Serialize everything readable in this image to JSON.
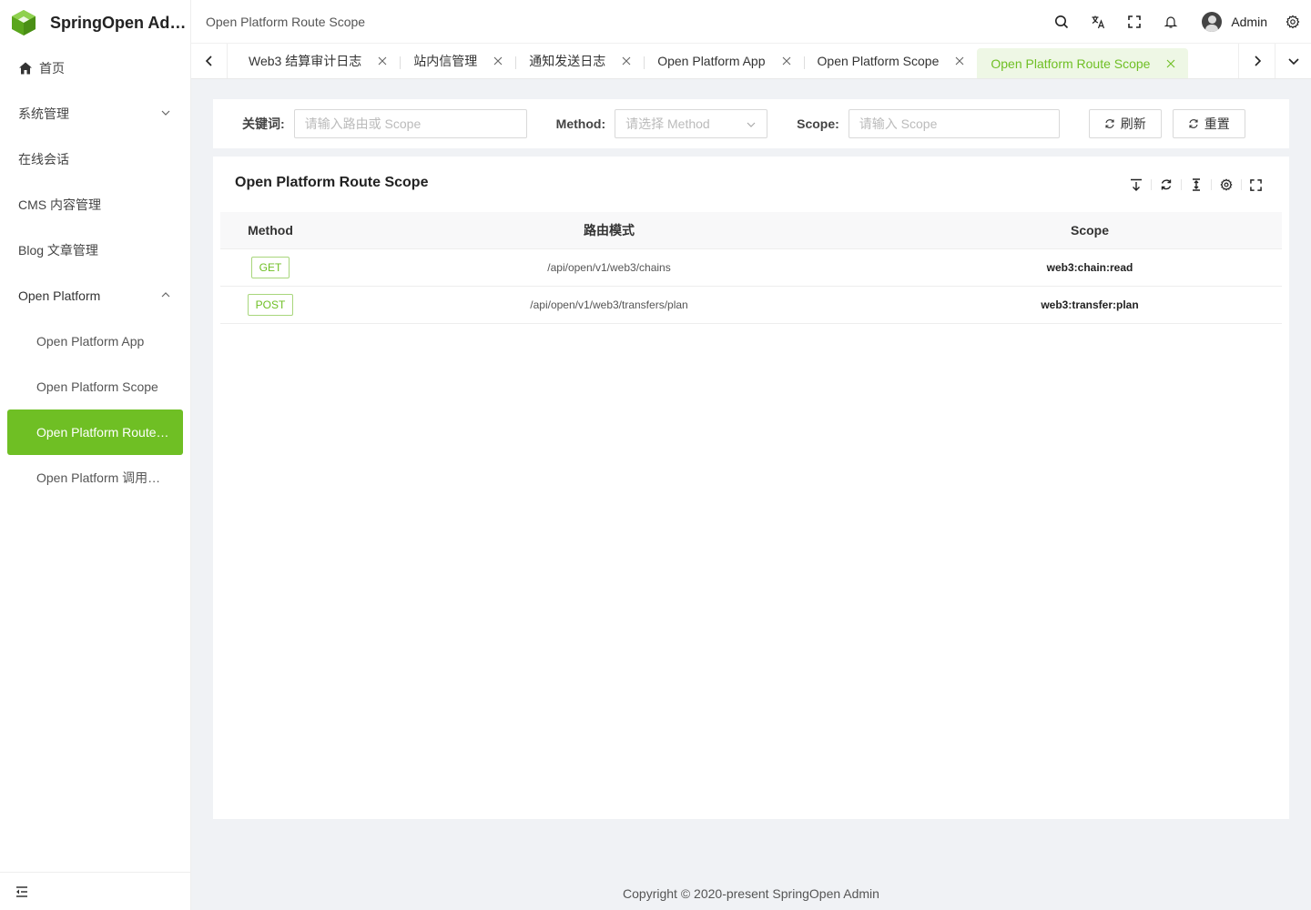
{
  "app": {
    "title": "SpringOpen Admin"
  },
  "sidebar": {
    "items": [
      {
        "label": "首页"
      },
      {
        "label": "系统管理"
      },
      {
        "label": "在线会话"
      },
      {
        "label": "CMS 内容管理"
      },
      {
        "label": "Blog 文章管理"
      },
      {
        "label": "Open Platform"
      },
      {
        "label": "Open Platform App"
      },
      {
        "label": "Open Platform Scope"
      },
      {
        "label": "Open Platform Route Scope"
      },
      {
        "label": "Open Platform 调用日志"
      }
    ]
  },
  "header": {
    "breadcrumb": "Open Platform Route Scope",
    "username": "Admin"
  },
  "tabs": [
    {
      "label": "Web3 结算审计日志"
    },
    {
      "label": "站内信管理"
    },
    {
      "label": "通知发送日志"
    },
    {
      "label": "Open Platform App"
    },
    {
      "label": "Open Platform Scope"
    },
    {
      "label": "Open Platform Route Scope"
    }
  ],
  "search": {
    "keyword_label": "关键词:",
    "keyword_placeholder": "请输入路由或 Scope",
    "method_label": "Method:",
    "method_placeholder": "请选择 Method",
    "scope_label": "Scope:",
    "scope_placeholder": "请输入 Scope",
    "refresh_label": "刷新",
    "reset_label": "重置"
  },
  "table": {
    "title": "Open Platform Route Scope",
    "columns": [
      "Method",
      "路由模式",
      "Scope"
    ],
    "rows": [
      {
        "method": "GET",
        "route": "/api/open/v1/web3/chains",
        "scope": "web3:chain:read"
      },
      {
        "method": "POST",
        "route": "/api/open/v1/web3/transfers/plan",
        "scope": "web3:transfer:plan"
      }
    ]
  },
  "footer": {
    "copyright": "Copyright © 2020-present SpringOpen Admin"
  },
  "colors": {
    "accent": "#6fbf24",
    "logo": "#5aa61c"
  }
}
